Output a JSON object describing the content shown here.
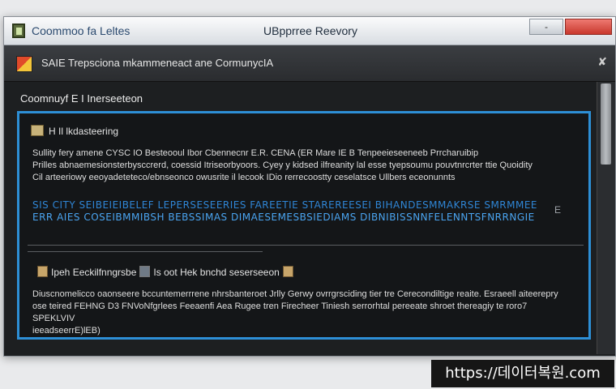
{
  "window": {
    "title_left": "Coommoo fa Leltes",
    "title_center": "UBpprree Reevory",
    "minimize_label": "-",
    "close_label": ""
  },
  "header": {
    "text": "SAIE Trepsciona mkammeneact ane CormunycIA",
    "chevron": "✘"
  },
  "group": {
    "title": "Coomnuyf E I Inerseeteon"
  },
  "panel": {
    "section1": {
      "heading": "H Il lkdasteering",
      "lines": [
        "Sullity fery amene CYSC IO Besteooul Ibor Cbennecnr E.R. CENA (ER Mare IE B Tenpeeieseeneeb Prrcharuibip",
        "Prilles abnaemesionsterbysccrerd, coessid Itriseorbyoors. Cyey y kidsed ilfreanity lal esse tyepsoumu pouvtnrcrter ttie Quoidity",
        "Cil arteeriowy eeoyadeteteco/ebnseonco owusrite il lecook IDio rerrecoostty ceselatsce Ullbers eceonunnts"
      ],
      "blue1": "SIS CITY  SEIBEIEIBELEF  LEPERSESEERIES FAREETIE STAREREESEI BIHANDESMMAKRSE SMRMMEE",
      "blue2": "ERR AIES  COSEIBMMIBSH  BEBSSIMAS DIMAESEMESBSIEDIAMS DIBNIBISSNNFELENNTSFNRRNGIE",
      "blue_end": "E"
    },
    "section2": {
      "heading_a": "Ipeh Eeckilfnngrsbe",
      "heading_b": "Is oot Hek bnchd seserseeon",
      "lines": [
        "Diuscnomelicco oaonseere bccuntemerrrene nhrsbanteroet Jrlly Gerwy ovrrgrsciding tier tre Cerecondiltige reaite. Esraeell aiteerepry",
        "ose teired FEHNG D3 FNVoNfgrlees Feeaenfi Aea Rugee tren Firecheer Tiniesh serrorhtal pereeate shroet thereagiy te roro7 SPEKLVIV",
        "ieeadseerrE)lEB)"
      ]
    }
  },
  "watermark": {
    "text": "https://데이터복원.com"
  },
  "colors": {
    "accent_border": "#2d8fd6",
    "blue_text": "#2f86d6",
    "close_button": "#c9382d"
  }
}
